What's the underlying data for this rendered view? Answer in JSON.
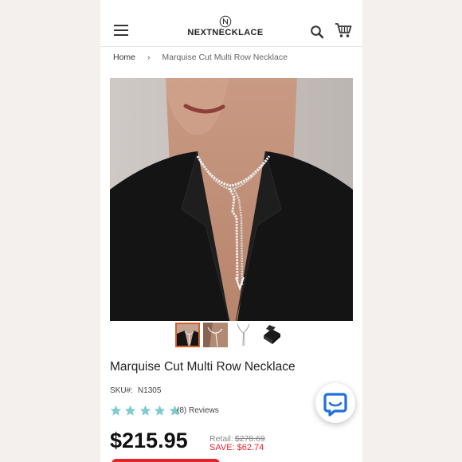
{
  "header": {
    "brand": "NEXTNECKLACE",
    "menu_icon": "hamburger-menu-icon",
    "search_icon": "search-icon",
    "cart_icon": "shopping-cart-icon"
  },
  "breadcrumb": {
    "home": "Home",
    "current": "Marquise Cut Multi Row Necklace"
  },
  "product": {
    "title": "Marquise Cut Multi Row Necklace",
    "sku_label": "SKU#:",
    "sku": "N1305",
    "rating": 5,
    "reviews": "(8) Reviews",
    "price": "$215.95",
    "retail_label": "Retail:",
    "retail_price": "$278.69",
    "save_label": "SAVE: $62.74",
    "thumbnails": [
      "model-wearing-necklace",
      "necklace-close-up",
      "necklace-flat-lay",
      "necklace-in-box"
    ],
    "active_thumbnail": 0
  },
  "colors": {
    "accent": "#d5612a",
    "star": "#7ecbd1",
    "save": "#e0262b",
    "chat": "#1e6fd9"
  }
}
